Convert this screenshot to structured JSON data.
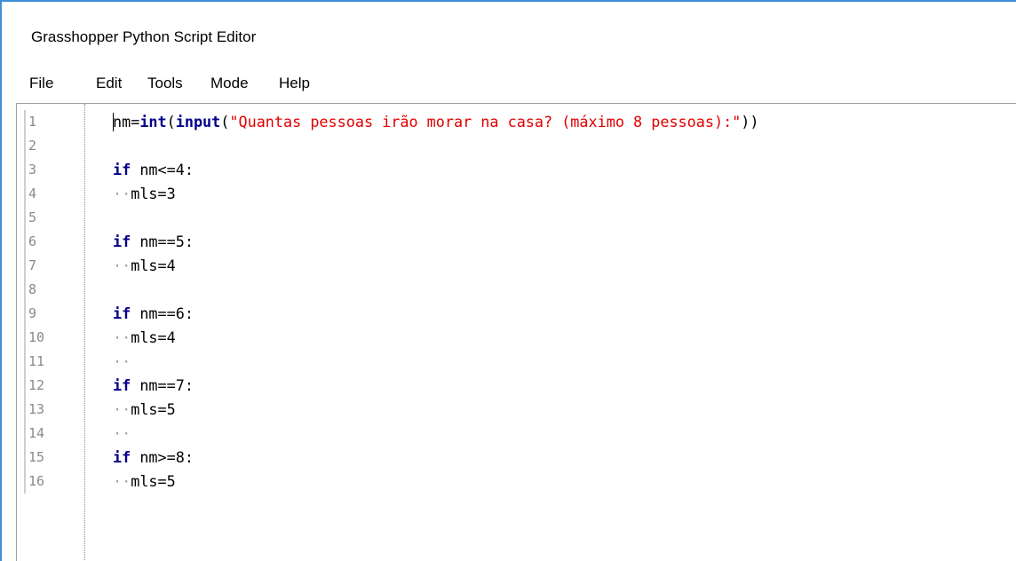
{
  "window": {
    "title": "Grasshopper Python Script Editor",
    "accent_color": "#3c8fd8"
  },
  "menu": {
    "items": [
      "File",
      "Edit",
      "Tools",
      "Mode",
      "Help"
    ]
  },
  "editor": {
    "lines": [
      {
        "number": "1",
        "tokens": [
          {
            "t": "nm",
            "k": "name"
          },
          {
            "t": "=",
            "k": "op"
          },
          {
            "t": "int",
            "k": "builtin"
          },
          {
            "t": "(",
            "k": "op"
          },
          {
            "t": "input",
            "k": "builtin"
          },
          {
            "t": "(",
            "k": "op"
          },
          {
            "t": "\"Quantas pessoas irão morar na casa? (máximo 8 pessoas):\"",
            "k": "str"
          },
          {
            "t": "))",
            "k": "op"
          }
        ]
      },
      {
        "number": "2",
        "tokens": []
      },
      {
        "number": "3",
        "tokens": [
          {
            "t": "if",
            "k": "kw"
          },
          {
            "t": " nm<=4:",
            "k": "name"
          }
        ]
      },
      {
        "number": "4",
        "tokens": [
          {
            "t": "··",
            "k": "ws"
          },
          {
            "t": "mls=3",
            "k": "name"
          }
        ]
      },
      {
        "number": "5",
        "tokens": []
      },
      {
        "number": "6",
        "tokens": [
          {
            "t": "if",
            "k": "kw"
          },
          {
            "t": " nm==5:",
            "k": "name"
          }
        ]
      },
      {
        "number": "7",
        "tokens": [
          {
            "t": "··",
            "k": "ws"
          },
          {
            "t": "mls=4",
            "k": "name"
          }
        ]
      },
      {
        "number": "8",
        "tokens": []
      },
      {
        "number": "9",
        "tokens": [
          {
            "t": "if",
            "k": "kw"
          },
          {
            "t": " nm==6:",
            "k": "name"
          }
        ]
      },
      {
        "number": "10",
        "tokens": [
          {
            "t": "··",
            "k": "ws"
          },
          {
            "t": "mls=4",
            "k": "name"
          }
        ]
      },
      {
        "number": "11",
        "tokens": [
          {
            "t": "··",
            "k": "ws"
          }
        ]
      },
      {
        "number": "12",
        "tokens": [
          {
            "t": "if",
            "k": "kw"
          },
          {
            "t": " nm==7:",
            "k": "name"
          }
        ]
      },
      {
        "number": "13",
        "tokens": [
          {
            "t": "··",
            "k": "ws"
          },
          {
            "t": "mls=5",
            "k": "name"
          }
        ]
      },
      {
        "number": "14",
        "tokens": [
          {
            "t": "··",
            "k": "ws"
          }
        ]
      },
      {
        "number": "15",
        "tokens": [
          {
            "t": "if",
            "k": "kw"
          },
          {
            "t": " nm>=8:",
            "k": "name"
          }
        ]
      },
      {
        "number": "16",
        "tokens": [
          {
            "t": "··",
            "k": "ws"
          },
          {
            "t": "mls=5",
            "k": "name"
          }
        ]
      }
    ],
    "colors": {
      "keyword": "#00008b",
      "string": "#e00000",
      "line_number": "#8a8a8a",
      "whitespace_marker": "#9fa39f"
    }
  }
}
